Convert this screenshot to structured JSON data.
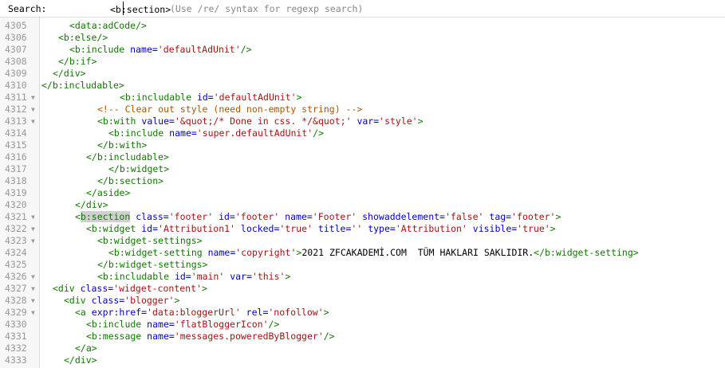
{
  "search": {
    "label": "Search:",
    "value": "<b:section>",
    "hint": "(Use /re/ syntax for regexp search)"
  },
  "lines": [
    {
      "n": "4305",
      "fold": false,
      "indent": 5,
      "tokens": [
        {
          "t": "tag",
          "v": "<data:adCode/>"
        }
      ]
    },
    {
      "n": "4306",
      "fold": false,
      "indent": 3,
      "tokens": [
        {
          "t": "tag",
          "v": "<b:else/>"
        }
      ]
    },
    {
      "n": "4307",
      "fold": false,
      "indent": 5,
      "tokens": [
        {
          "t": "tag",
          "v": "<b:include "
        },
        {
          "t": "attr",
          "v": "name="
        },
        {
          "t": "str",
          "v": "'defaultAdUnit'"
        },
        {
          "t": "tag",
          "v": "/>"
        }
      ]
    },
    {
      "n": "4308",
      "fold": false,
      "indent": 3,
      "tokens": [
        {
          "t": "tag",
          "v": "</b:if>"
        }
      ]
    },
    {
      "n": "4309",
      "fold": false,
      "indent": 2,
      "tokens": [
        {
          "t": "tag",
          "v": "</div>"
        }
      ]
    },
    {
      "n": "4310",
      "fold": false,
      "indent": 0,
      "tokens": [
        {
          "t": "tag",
          "v": "</b:includable>"
        }
      ]
    },
    {
      "n": "4311",
      "fold": true,
      "indent": 14,
      "tokens": [
        {
          "t": "tag",
          "v": "<b:includable "
        },
        {
          "t": "attr",
          "v": "id="
        },
        {
          "t": "str",
          "v": "'defaultAdUnit'"
        },
        {
          "t": "tag",
          "v": ">"
        }
      ]
    },
    {
      "n": "4312",
      "fold": true,
      "indent": 10,
      "tokens": [
        {
          "t": "cmt",
          "v": "<!-- Clear out style (need non-empty string) -->"
        }
      ]
    },
    {
      "n": "4313",
      "fold": true,
      "indent": 10,
      "tokens": [
        {
          "t": "tag",
          "v": "<b:with "
        },
        {
          "t": "attr",
          "v": "value="
        },
        {
          "t": "str",
          "v": "'&quot;/* Done in css. */&quot;'"
        },
        {
          "t": "txt",
          "v": " "
        },
        {
          "t": "attr",
          "v": "var="
        },
        {
          "t": "str",
          "v": "'style'"
        },
        {
          "t": "tag",
          "v": ">"
        }
      ]
    },
    {
      "n": "4314",
      "fold": false,
      "indent": 12,
      "tokens": [
        {
          "t": "tag",
          "v": "<b:include "
        },
        {
          "t": "attr",
          "v": "name="
        },
        {
          "t": "str",
          "v": "'super.defaultAdUnit'"
        },
        {
          "t": "tag",
          "v": "/>"
        }
      ]
    },
    {
      "n": "4315",
      "fold": false,
      "indent": 10,
      "tokens": [
        {
          "t": "tag",
          "v": "</b:with>"
        }
      ]
    },
    {
      "n": "4316",
      "fold": false,
      "indent": 8,
      "tokens": [
        {
          "t": "tag",
          "v": "</b:includable>"
        }
      ]
    },
    {
      "n": "4317",
      "fold": false,
      "indent": 12,
      "tokens": [
        {
          "t": "tag",
          "v": "</b:widget>"
        }
      ]
    },
    {
      "n": "4318",
      "fold": false,
      "indent": 10,
      "tokens": [
        {
          "t": "tag",
          "v": "</b:section>"
        }
      ]
    },
    {
      "n": "4319",
      "fold": false,
      "indent": 8,
      "tokens": [
        {
          "t": "tag",
          "v": "</aside>"
        }
      ]
    },
    {
      "n": "4320",
      "fold": false,
      "indent": 6,
      "tokens": [
        {
          "t": "tag",
          "v": "</div>"
        }
      ]
    },
    {
      "n": "4321",
      "fold": true,
      "indent": 6,
      "tokens": [
        {
          "t": "tag",
          "v": "<"
        },
        {
          "t": "taghl",
          "v": "b:section"
        },
        {
          "t": "tag",
          "v": " "
        },
        {
          "t": "attr",
          "v": "class="
        },
        {
          "t": "str",
          "v": "'footer'"
        },
        {
          "t": "txt",
          "v": " "
        },
        {
          "t": "attr",
          "v": "id="
        },
        {
          "t": "str",
          "v": "'footer'"
        },
        {
          "t": "txt",
          "v": " "
        },
        {
          "t": "attr",
          "v": "name="
        },
        {
          "t": "str",
          "v": "'Footer'"
        },
        {
          "t": "txt",
          "v": " "
        },
        {
          "t": "attr",
          "v": "showaddelement="
        },
        {
          "t": "str",
          "v": "'false'"
        },
        {
          "t": "txt",
          "v": " "
        },
        {
          "t": "attr",
          "v": "tag="
        },
        {
          "t": "str",
          "v": "'footer'"
        },
        {
          "t": "tag",
          "v": ">"
        }
      ]
    },
    {
      "n": "4322",
      "fold": true,
      "indent": 8,
      "tokens": [
        {
          "t": "tag",
          "v": "<b:widget "
        },
        {
          "t": "attr",
          "v": "id="
        },
        {
          "t": "str",
          "v": "'Attribution1'"
        },
        {
          "t": "txt",
          "v": " "
        },
        {
          "t": "attr",
          "v": "locked="
        },
        {
          "t": "str",
          "v": "'true'"
        },
        {
          "t": "txt",
          "v": " "
        },
        {
          "t": "attr",
          "v": "title="
        },
        {
          "t": "str",
          "v": "''"
        },
        {
          "t": "txt",
          "v": " "
        },
        {
          "t": "attr",
          "v": "type="
        },
        {
          "t": "str",
          "v": "'Attribution'"
        },
        {
          "t": "txt",
          "v": " "
        },
        {
          "t": "attr",
          "v": "visible="
        },
        {
          "t": "str",
          "v": "'true'"
        },
        {
          "t": "tag",
          "v": ">"
        }
      ]
    },
    {
      "n": "4323",
      "fold": true,
      "indent": 10,
      "tokens": [
        {
          "t": "tag",
          "v": "<b:widget-settings>"
        }
      ]
    },
    {
      "n": "4324",
      "fold": false,
      "indent": 12,
      "tokens": [
        {
          "t": "tag",
          "v": "<b:widget-setting "
        },
        {
          "t": "attr",
          "v": "name="
        },
        {
          "t": "str",
          "v": "'copyright'"
        },
        {
          "t": "tag",
          "v": ">"
        },
        {
          "t": "txt",
          "v": "2021 ZFCAKADEMİ.COM  TÜM HAKLARI SAKLIDIR."
        },
        {
          "t": "tag",
          "v": "</b:widget-setting>"
        }
      ]
    },
    {
      "n": "4325",
      "fold": false,
      "indent": 10,
      "tokens": [
        {
          "t": "tag",
          "v": "</b:widget-settings>"
        }
      ]
    },
    {
      "n": "4326",
      "fold": true,
      "indent": 10,
      "tokens": [
        {
          "t": "tag",
          "v": "<b:includable "
        },
        {
          "t": "attr",
          "v": "id="
        },
        {
          "t": "str",
          "v": "'main'"
        },
        {
          "t": "txt",
          "v": " "
        },
        {
          "t": "attr",
          "v": "var="
        },
        {
          "t": "str",
          "v": "'this'"
        },
        {
          "t": "tag",
          "v": ">"
        }
      ]
    },
    {
      "n": "4327",
      "fold": true,
      "indent": 2,
      "tokens": [
        {
          "t": "tag",
          "v": "<div "
        },
        {
          "t": "attr",
          "v": "class="
        },
        {
          "t": "str",
          "v": "'widget-content'"
        },
        {
          "t": "tag",
          "v": ">"
        }
      ]
    },
    {
      "n": "4328",
      "fold": true,
      "indent": 4,
      "tokens": [
        {
          "t": "tag",
          "v": "<div "
        },
        {
          "t": "attr",
          "v": "class="
        },
        {
          "t": "str",
          "v": "'blogger'"
        },
        {
          "t": "tag",
          "v": ">"
        }
      ]
    },
    {
      "n": "4329",
      "fold": true,
      "indent": 6,
      "tokens": [
        {
          "t": "tag",
          "v": "<a "
        },
        {
          "t": "attr",
          "v": "expr:href="
        },
        {
          "t": "str",
          "v": "'data:bloggerUrl'"
        },
        {
          "t": "txt",
          "v": " "
        },
        {
          "t": "attr",
          "v": "rel="
        },
        {
          "t": "str",
          "v": "'nofollow'"
        },
        {
          "t": "tag",
          "v": ">"
        }
      ]
    },
    {
      "n": "4330",
      "fold": false,
      "indent": 8,
      "tokens": [
        {
          "t": "tag",
          "v": "<b:include "
        },
        {
          "t": "attr",
          "v": "name="
        },
        {
          "t": "str",
          "v": "'flatBloggerIcon'"
        },
        {
          "t": "tag",
          "v": "/>"
        }
      ]
    },
    {
      "n": "4331",
      "fold": false,
      "indent": 8,
      "tokens": [
        {
          "t": "tag",
          "v": "<b:message "
        },
        {
          "t": "attr",
          "v": "name="
        },
        {
          "t": "str",
          "v": "'messages.poweredByBlogger'"
        },
        {
          "t": "tag",
          "v": "/>"
        }
      ]
    },
    {
      "n": "4332",
      "fold": false,
      "indent": 6,
      "tokens": [
        {
          "t": "tag",
          "v": "</a>"
        }
      ]
    },
    {
      "n": "4333",
      "fold": false,
      "indent": 4,
      "tokens": [
        {
          "t": "tag",
          "v": "</div>"
        }
      ]
    }
  ]
}
